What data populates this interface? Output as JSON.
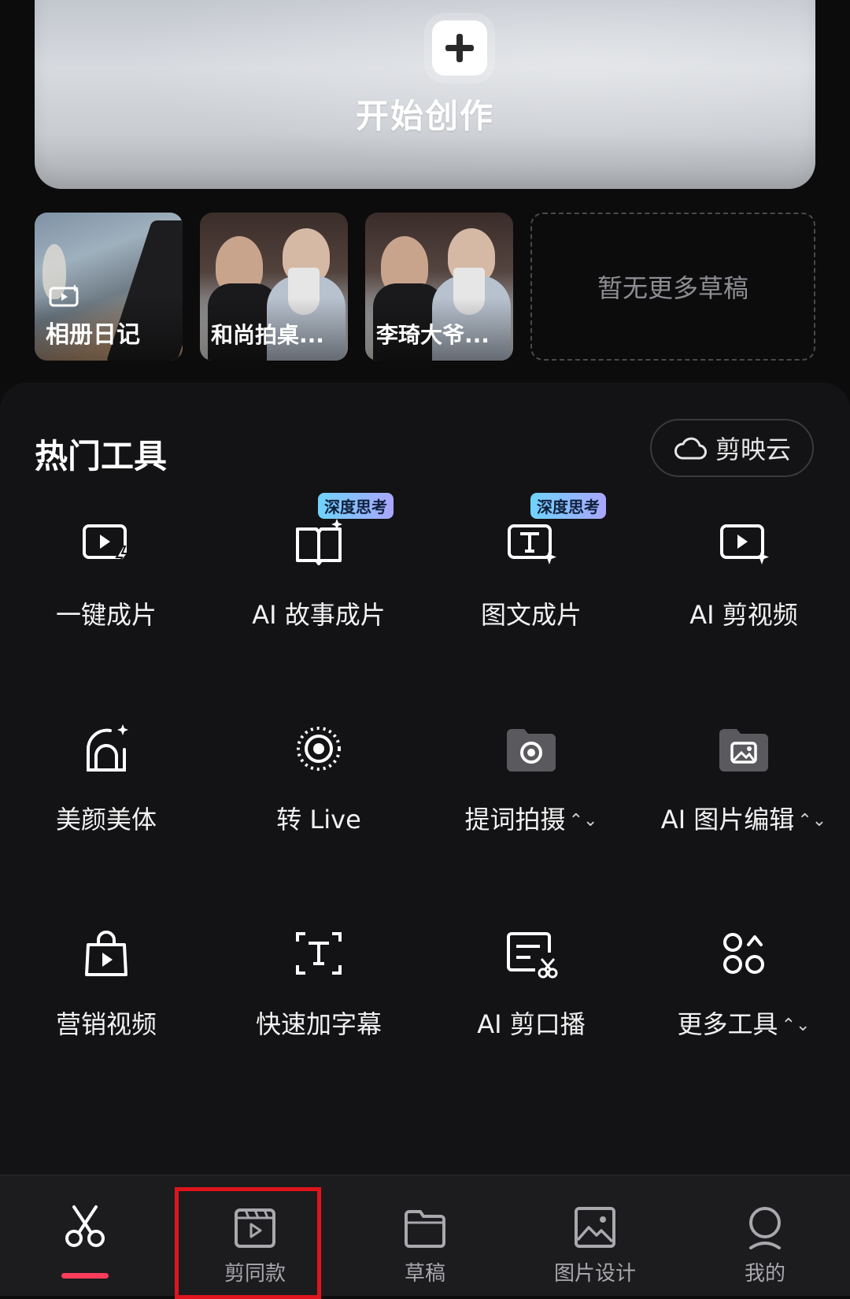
{
  "banner": {
    "label": "开始创作"
  },
  "drafts": {
    "items": [
      {
        "name": "相册日记"
      },
      {
        "name": "和尚拍桌..."
      },
      {
        "name": "李琦大爷..."
      }
    ],
    "empty_text": "暂无更多草稿"
  },
  "tools_section": {
    "title": "热门工具",
    "cloud_button": "剪映云",
    "tools": [
      {
        "label": "一键成片",
        "icon": "play-flash-icon"
      },
      {
        "label": "AI 故事成片",
        "icon": "book-sparkle-icon",
        "badge": "深度思考"
      },
      {
        "label": "图文成片",
        "icon": "text-sparkle-icon",
        "badge": "深度思考"
      },
      {
        "label": "AI 剪视频",
        "icon": "play-sparkle-icon"
      },
      {
        "label": "美颜美体",
        "icon": "beauty-icon"
      },
      {
        "label": "转 Live",
        "icon": "live-icon"
      },
      {
        "label": "提词拍摄",
        "icon": "camera-folder-icon",
        "has_arrow": true
      },
      {
        "label": "AI 图片编辑",
        "icon": "image-folder-icon",
        "has_arrow": true
      },
      {
        "label": "营销视频",
        "icon": "shopping-bag-icon"
      },
      {
        "label": "快速加字幕",
        "icon": "subtitle-icon"
      },
      {
        "label": "AI 剪口播",
        "icon": "script-cut-icon"
      },
      {
        "label": "更多工具",
        "icon": "more-tools-icon",
        "has_arrow": true
      }
    ],
    "arrow_glyph": "⌃⌄"
  },
  "bottom_nav": {
    "items": [
      {
        "label": "",
        "icon": "scissors-icon",
        "active": true
      },
      {
        "label": "剪同款",
        "icon": "template-icon"
      },
      {
        "label": "草稿",
        "icon": "folder-icon"
      },
      {
        "label": "图片设计",
        "icon": "image-icon"
      },
      {
        "label": "我的",
        "icon": "profile-icon"
      }
    ]
  },
  "colors": {
    "background": "#0c0c0d",
    "panel": "#131315",
    "accent": "#ff3b5c",
    "highlight_box": "#e0141c",
    "badge_gradient": [
      "#6fd3ff",
      "#a9a6ff"
    ]
  }
}
